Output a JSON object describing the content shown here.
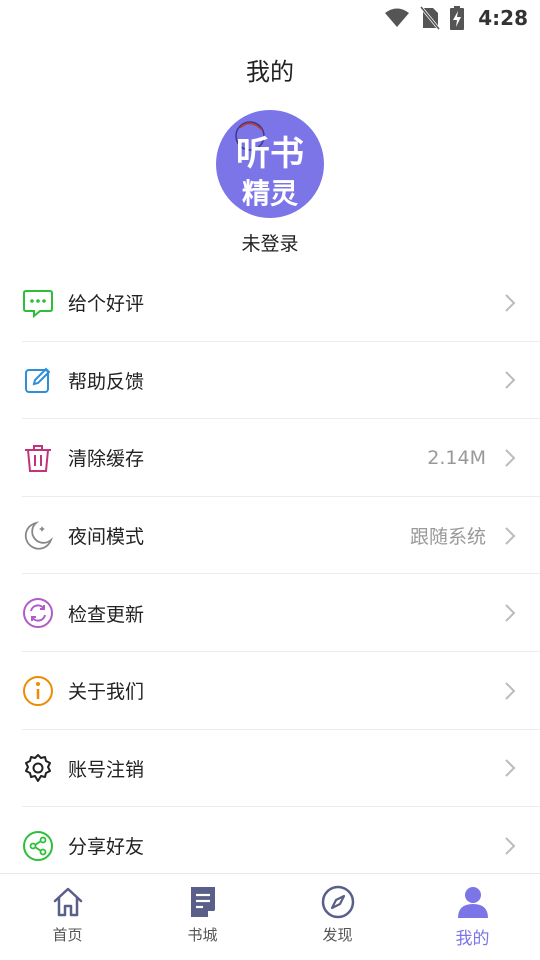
{
  "status_bar": {
    "time": "4:28"
  },
  "page_title": "我的",
  "avatar": {
    "line1": "听书",
    "line2": "精灵"
  },
  "username": "未登录",
  "menu": [
    {
      "label": "给个好评",
      "value": "",
      "icon": "comment-icon",
      "color": "#2dbf3a"
    },
    {
      "label": "帮助反馈",
      "value": "",
      "icon": "edit-icon",
      "color": "#2d8fd8"
    },
    {
      "label": "清除缓存",
      "value": "2.14M",
      "icon": "trash-icon",
      "color": "#c2337a"
    },
    {
      "label": "夜间模式",
      "value": "跟随系统",
      "icon": "moon-icon",
      "color": "#888888"
    },
    {
      "label": "检查更新",
      "value": "",
      "icon": "refresh-icon",
      "color": "#b05cc9"
    },
    {
      "label": "关于我们",
      "value": "",
      "icon": "info-icon",
      "color": "#f08a00"
    },
    {
      "label": "账号注销",
      "value": "",
      "icon": "gear-icon",
      "color": "#222222"
    },
    {
      "label": "分享好友",
      "value": "",
      "icon": "share-icon",
      "color": "#2dbf3a"
    }
  ],
  "bottom_nav": [
    {
      "label": "首页",
      "icon": "home-icon"
    },
    {
      "label": "书城",
      "icon": "book-icon"
    },
    {
      "label": "发现",
      "icon": "compass-icon"
    },
    {
      "label": "我的",
      "icon": "user-icon",
      "active": true
    }
  ],
  "colors": {
    "accent": "#7b75e8",
    "nav_icon": "#5a5f8a"
  }
}
